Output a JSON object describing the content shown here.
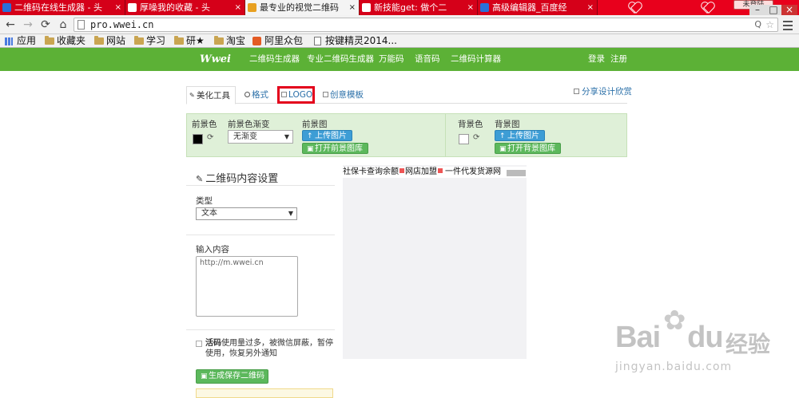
{
  "browser": {
    "tabs": [
      {
        "title": "二维码在线生成器 - 头",
        "favicon_color": "#2a6fd8",
        "active": false
      },
      {
        "title": "厚噪我的收藏 - 头",
        "favicon_color": "#ffffff",
        "active": false
      },
      {
        "title": "最专业的视觉二维码",
        "favicon_color": "#e8a020",
        "active": true
      },
      {
        "title": "新技能get: 做个二",
        "favicon_color": "#ffffff",
        "active": false
      },
      {
        "title": "高级编辑器_百度经",
        "favicon_color": "#2a6fd8",
        "active": false
      }
    ],
    "login_chip": "未登陆",
    "tab_close_glyph": "×",
    "url": "pro.wwei.cn",
    "nav": {
      "back": "←",
      "forward": "→",
      "reload": "⟳",
      "home": "⌂"
    },
    "omnibox_icons": {
      "zoom": "Q",
      "star": "☆"
    },
    "window_controls": {
      "minimize": "–",
      "maximize": "□",
      "close": "×"
    }
  },
  "bookmarks": [
    {
      "label": "应用",
      "icon": "apps-grid-icon"
    },
    {
      "label": "收藏夹",
      "icon": "folder-icon"
    },
    {
      "label": "网站",
      "icon": "folder-icon"
    },
    {
      "label": "学习",
      "icon": "folder-icon"
    },
    {
      "label": "研★",
      "icon": "folder-icon"
    },
    {
      "label": "淘宝",
      "icon": "folder-icon"
    },
    {
      "label": "阿里众包",
      "icon": "taobao-icon"
    },
    {
      "label": "按键精灵2014...",
      "icon": "page-icon"
    }
  ],
  "site": {
    "logo": "Wwei",
    "nav": [
      "二维码生成器",
      "专业二维码生成器",
      "万能码",
      "语音码",
      "二维码计算器"
    ],
    "login": "登录",
    "register": "注册"
  },
  "tool_tabs": {
    "beautify": "美化工具",
    "format": "格式",
    "logo": "LOGO",
    "creative": "创意模板",
    "share": "分享设计欣赏"
  },
  "color_panel": {
    "fg_label": "前景色",
    "fg_color": "#000000",
    "gradient_label": "前景色渐变",
    "gradient_value": "无渐变",
    "fg_image_label": "前景图",
    "upload_label": "上传图片",
    "open_fg_gallery": "打开前景图库",
    "bg_label": "背景色",
    "bg_color": "#ffffff",
    "bg_image_label": "背景图",
    "upload_bg_label": "上传图片",
    "open_bg_gallery": "打开背景图库",
    "refresh_glyph": "⟳",
    "upload_glyph": "↑",
    "gallery_glyph": "▣"
  },
  "form": {
    "title": "二维码内容设置",
    "type_label": "类型",
    "type_value": "文本",
    "content_label": "输入内容",
    "content_value": "http://m.wwei.cn",
    "live_code_bold": "活码",
    "live_code_note": "使用量过多，被微信屏蔽，暂停使用，恢复另外通知",
    "generate_label": "生成保存二维码"
  },
  "preview_ads": [
    {
      "text": "社保卡查询余额"
    },
    {
      "text": "网店加盟"
    },
    {
      "text": "一件代发货源网"
    }
  ],
  "watermark": {
    "brand": "Bai",
    "brand2": "du",
    "cn": "经验",
    "url": "jingyan.baidu.com"
  },
  "colors": {
    "tab_bar_red": "#e8001c",
    "site_green": "#5cb136",
    "highlight_red": "#e3001b",
    "link_blue": "#2a6fa8",
    "panel_green": "#dff0d8"
  }
}
